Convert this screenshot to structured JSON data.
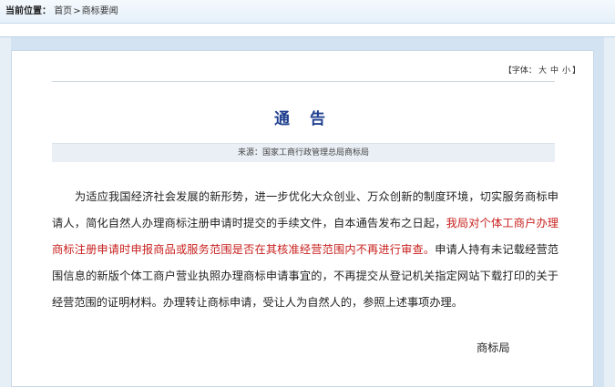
{
  "breadcrumb": {
    "label": "当前位置：",
    "home": "首页",
    "separator": ">",
    "current": "商标要闻"
  },
  "font_size": {
    "open": "【字体：",
    "large": "大",
    "medium": "中",
    "small": "小",
    "close": "】"
  },
  "article": {
    "title": "通 告",
    "source": "来源：国家工商行政管理总局商标局",
    "body_part1": "为适应我国经济社会发展的新形势，进一步优化大众创业、万众创新的制度环境，切实服务商标申请人，简化自然人办理商标注册申请时提交的手续文件，自本通告发布之日起，",
    "body_red": "我局对个体工商户办理商标注册申请时申报商品或服务范围是否在其核准经营范围内不再进行审查。",
    "body_part2": "申请人持有未记载经营范围信息的新版个体工商户营业执照办理商标申请事宜的，不再提交从登记机关指定网站下载打印的关于经营范围的证明材料。办理转让商标申请，受让人为自然人的，参照上述事项办理。",
    "signature": "商标局"
  },
  "colors": {
    "title": "#1f3f8f",
    "highlight": "#c8201e",
    "frame": "#d4e3f1"
  }
}
